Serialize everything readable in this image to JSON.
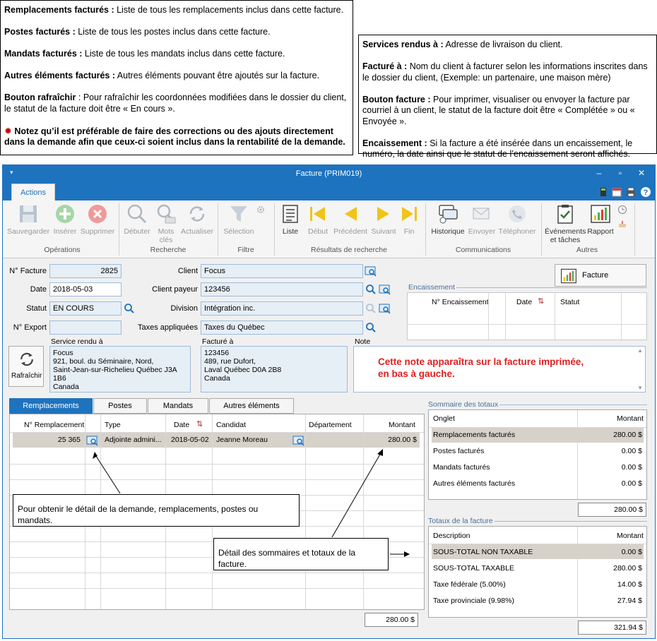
{
  "callout_left": {
    "items": [
      {
        "term": "Remplacements facturés :",
        "desc": " Liste de tous les remplacements inclus dans cette facture."
      },
      {
        "term": "Postes facturés :",
        "desc": " Liste de tous les postes inclus dans cette facture."
      },
      {
        "term": "Mandats facturés :",
        "desc": " Liste de tous les mandats inclus dans cette facture."
      },
      {
        "term": "Autres éléments facturés :",
        "desc": " Autres éléments pouvant être ajoutés sur la facture."
      },
      {
        "term": "Bouton rafraîchir",
        "desc": " : Pour rafraîchir les coordonnées modifiées dans le dossier du client, le statut de la facture doit être « En cours »."
      }
    ],
    "warning": "Notez qu’il est préférable de faire des corrections ou des ajouts directement dans la demande afin que ceux-ci soient inclus dans la rentabilité de la demande."
  },
  "callout_right": {
    "items": [
      {
        "term": "Services rendus à :",
        "desc": " Adresse de livraison du client."
      },
      {
        "term": "Facturé à :",
        "desc": " Nom du client à facturer selon les informations inscrites dans le dossier du client, (Exemple: un partenaire, une maison mère)"
      },
      {
        "term": "Bouton facture :",
        "desc": " Pour imprimer, visualiser ou envoyer la facture par courriel à un client, le statut de la facture doit être « Complétée » ou « Envoyée »."
      },
      {
        "term": "Encaissement :",
        "desc": " Si la facture a été insérée dans un encaissement, le numéro, la date ainsi que le statut de l’encaissement seront affichés."
      }
    ]
  },
  "callout_detail": "Pour obtenir le détail de la demande, remplacements, postes ou mandats.",
  "callout_totals": "Détail des sommaires et totaux de la facture.",
  "window": {
    "title": "Facture (PRIM019)",
    "active_tab": "Actions"
  },
  "ribbon": {
    "buttons": {
      "save": "Sauvegarder",
      "insert": "Insérer",
      "delete": "Supprimer",
      "start": "Débuter",
      "keywords": "Mots clés",
      "refresh": "Actualiser",
      "selection": "Sélection",
      "list": "Liste",
      "first": "Début",
      "prev": "Précédent",
      "next": "Suivant",
      "last": "Fin",
      "history": "Historique",
      "send": "Envoyer",
      "phone": "Téléphoner",
      "events": "Événements et tâches",
      "report": "Rapport"
    },
    "groups": {
      "operations": "Opérations",
      "search": "Recherche",
      "filter": "Filtre",
      "results": "Résultats de recherche",
      "communications": "Communications",
      "others": "Autres"
    }
  },
  "form": {
    "invoice_no_label": "N° Facture",
    "invoice_no": "2825",
    "date_label": "Date",
    "date": "2018-05-03",
    "status_label": "Statut",
    "status": "EN COURS",
    "export_label": "N° Export",
    "export": "",
    "client_label": "Client",
    "client": "Focus",
    "payer_label": "Client payeur",
    "payer": "123456",
    "division_label": "Division",
    "division": "Intégration inc.",
    "taxes_label": "Taxes appliquées",
    "taxes": "Taxes du Québec",
    "invoice_button": "Facture",
    "refresh_button": "Rafraîchir",
    "service_label": "Service rendu à",
    "service_lines": [
      "Focus",
      "921, boul. du Séminaire, Nord,",
      "Saint-Jean-sur-Richelieu Québec J3A 1B6",
      "Canada"
    ],
    "billed_label": "Facturé à",
    "billed_lines": [
      "123456",
      "489, rue Dufort,",
      "Laval Québec D0A 2B8",
      "Canada"
    ],
    "note_label": "Note",
    "note_lines": [
      "Cette note apparaîtra sur la facture imprimée,",
      "en bas à gauche."
    ]
  },
  "encaissement": {
    "label": "Encaissement",
    "columns": [
      "N° Encaissement",
      "Date",
      "Statut"
    ]
  },
  "tabs": [
    "Remplacements facturés",
    "Postes facturés",
    "Mandats facturés",
    "Autres éléments facturés"
  ],
  "grid": {
    "columns": [
      "N° Remplacement",
      "Type",
      "Date",
      "Candidat",
      "Département",
      "Montant"
    ],
    "rows": [
      {
        "no": "25 365",
        "type": "Adjointe admini...",
        "date": "2018-05-02",
        "candidat": "Jeanne Moreau",
        "dept": "",
        "montant": "280.00 $"
      }
    ],
    "total": "280.00 $"
  },
  "summary": {
    "label": "Sommaire des totaux",
    "col_onglet": "Onglet",
    "col_montant": "Montant",
    "rows": [
      {
        "name": "Remplacements facturés",
        "value": "280.00 $"
      },
      {
        "name": "Postes facturés",
        "value": "0.00 $"
      },
      {
        "name": "Mandats facturés",
        "value": "0.00 $"
      },
      {
        "name": "Autres éléments facturés",
        "value": "0.00 $"
      }
    ],
    "total": "280.00 $"
  },
  "totals": {
    "label": "Totaux de la facture",
    "col_desc": "Description",
    "col_montant": "Montant",
    "rows": [
      {
        "name": "SOUS-TOTAL NON TAXABLE",
        "value": "0.00 $"
      },
      {
        "name": "SOUS-TOTAL TAXABLE",
        "value": "280.00 $"
      },
      {
        "name": "Taxe fédérale (5.00%)",
        "value": "14.00 $"
      },
      {
        "name": "Taxe provinciale (9.98%)",
        "value": "27.94 $"
      }
    ],
    "total": "321.94 $"
  }
}
